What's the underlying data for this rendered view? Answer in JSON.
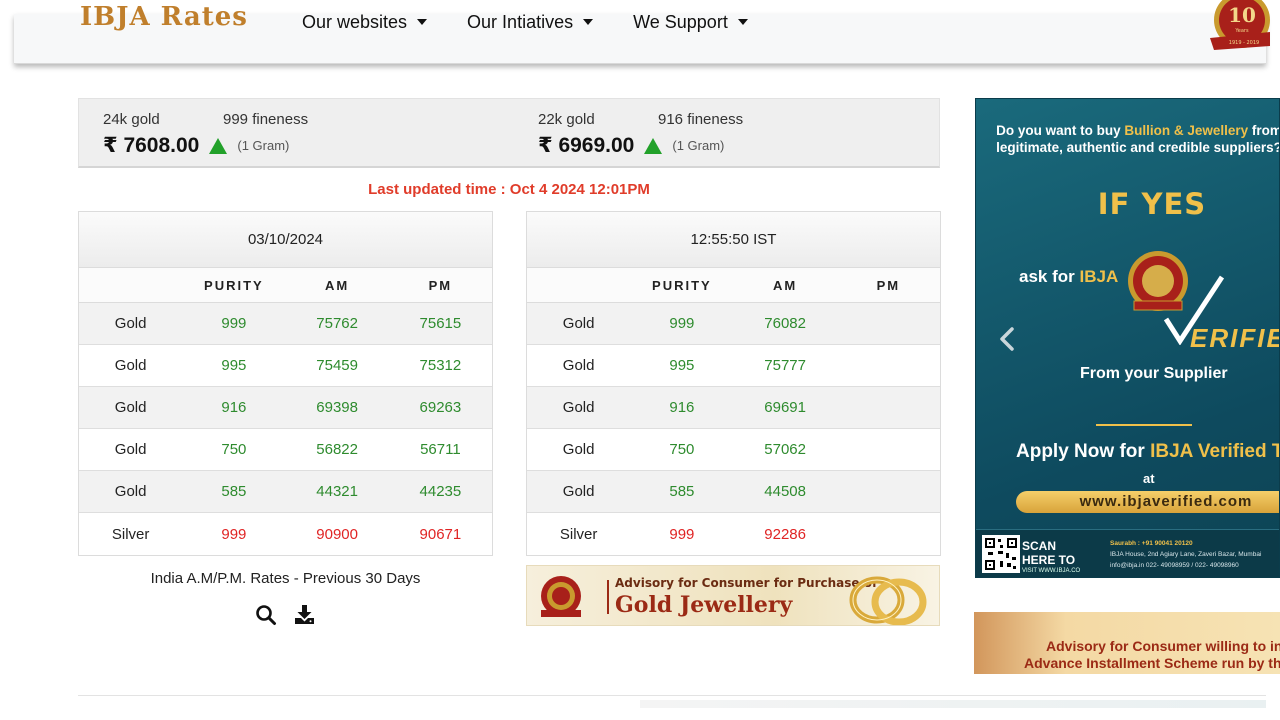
{
  "header": {
    "logo_text": "IBJA Rates",
    "nav": [
      {
        "label": "Our websites"
      },
      {
        "label": "Our Intiatives"
      },
      {
        "label": "We Support"
      }
    ],
    "badge_text": "10",
    "badge_years": "Years",
    "badge_range": "1919 - 2019"
  },
  "prices": {
    "g24": {
      "purity": "24k gold",
      "fineness": "999 fineness",
      "price": "₹ 7608.00",
      "unit": "(1 Gram)"
    },
    "g22": {
      "purity": "22k gold",
      "fineness": "916 fineness",
      "price": "₹ 6969.00",
      "unit": "(1 Gram)"
    }
  },
  "last_updated": "Last updated time : Oct 4 2024 12:01PM",
  "colors": {
    "up": "#22a12a",
    "green_value": "#2e8b2e",
    "red_value": "#e02424",
    "updated_text": "#e03c2a"
  },
  "table_left": {
    "title": "03/10/2024",
    "headers": [
      "",
      "PURITY",
      "AM",
      "PM"
    ],
    "rows": [
      {
        "metal": "Gold",
        "purity": "999",
        "am": "75762",
        "pm": "75615"
      },
      {
        "metal": "Gold",
        "purity": "995",
        "am": "75459",
        "pm": "75312"
      },
      {
        "metal": "Gold",
        "purity": "916",
        "am": "69398",
        "pm": "69263"
      },
      {
        "metal": "Gold",
        "purity": "750",
        "am": "56822",
        "pm": "56711"
      },
      {
        "metal": "Gold",
        "purity": "585",
        "am": "44321",
        "pm": "44235"
      },
      {
        "metal": "Silver",
        "purity": "999",
        "am": "90900",
        "pm": "90671"
      }
    ]
  },
  "table_right": {
    "title": "12:55:50 IST",
    "headers": [
      "",
      "PURITY",
      "AM",
      "PM"
    ],
    "rows": [
      {
        "metal": "Gold",
        "purity": "999",
        "am": "76082",
        "pm": ""
      },
      {
        "metal": "Gold",
        "purity": "995",
        "am": "75777",
        "pm": ""
      },
      {
        "metal": "Gold",
        "purity": "916",
        "am": "69691",
        "pm": ""
      },
      {
        "metal": "Gold",
        "purity": "750",
        "am": "57062",
        "pm": ""
      },
      {
        "metal": "Gold",
        "purity": "585",
        "am": "44508",
        "pm": ""
      },
      {
        "metal": "Silver",
        "purity": "999",
        "am": "92286",
        "pm": ""
      }
    ]
  },
  "prev_30_days": "India A.M/P.M. Rates - Previous 30 Days",
  "advisory_banner": {
    "line1": "Advisory for Consumer for Purchase of",
    "line2": "Gold Jewellery"
  },
  "side_ad": {
    "question_pre": "Do you want to buy ",
    "question_hl": "Bullion & Jewellery",
    "question_post": " from legitimate, authentic and credible suppliers?",
    "if_yes": "IF YES",
    "ask_pre": "ask for ",
    "ask_hl": "IBJA",
    "verified": "ERIFIED",
    "supplier": "From your Supplier",
    "apply_pre": "Apply Now for ",
    "apply_hl": "IBJA Verified Tag",
    "at": "at",
    "url": "www.ibjaverified.com",
    "scan1": "SCAN",
    "scan2": "HERE TO",
    "scan_small": "VISIT WWW.IBJA.CO",
    "contact_name": "Saurabh : +91 90041 20120",
    "contact_addr": "IBJA House, 2nd Agiary Lane, Zaveri Bazar, Mumbai",
    "contact_mail": "info@ibja.in     022- 49098959 / 022- 49098960"
  },
  "side_banner2": {
    "line1": "Advisory for Consumer willing to invest",
    "line2": "Advance Installment Scheme run by the"
  }
}
